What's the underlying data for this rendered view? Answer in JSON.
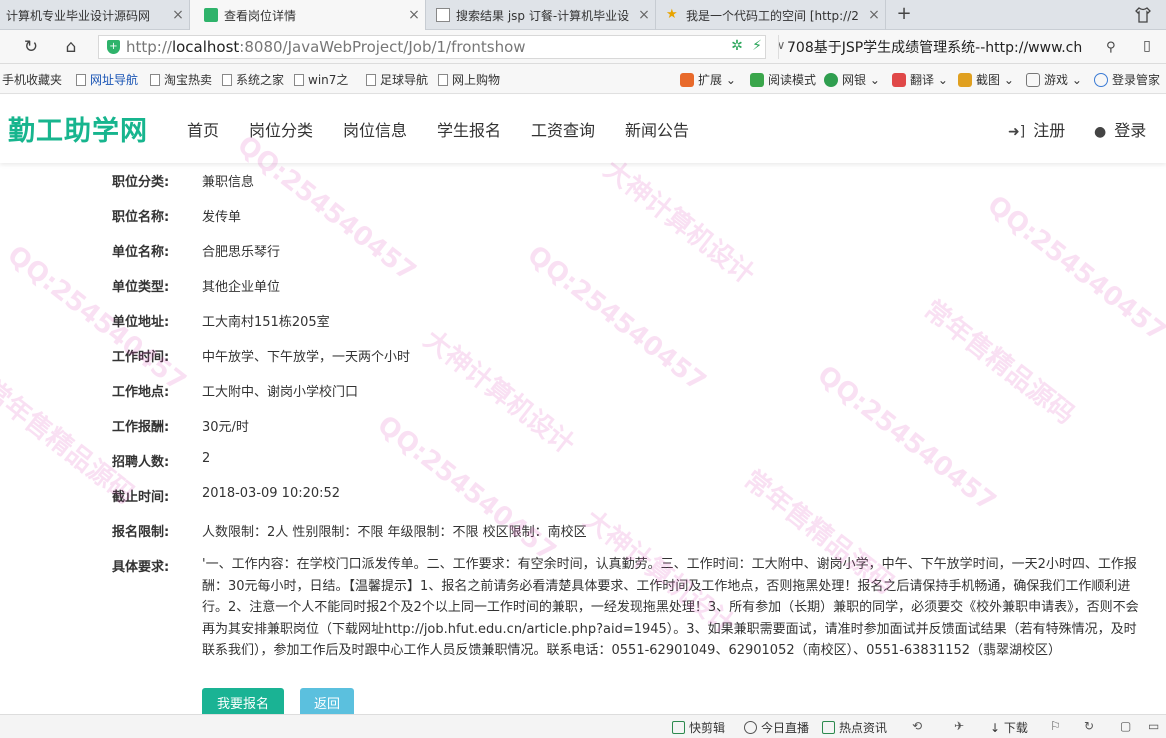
{
  "browser": {
    "tabs": [
      {
        "title": "计算机专业毕业设计源码网",
        "active": false
      },
      {
        "title": "查看岗位详情",
        "active": true
      },
      {
        "title": "搜索结果 jsp 订餐-计算机毕业设",
        "active": false
      },
      {
        "title": "我是一个代码工的空间 [http://2",
        "active": false
      }
    ],
    "new_tab_label": "+",
    "url_prefix": "http://",
    "url_host": "localhost",
    "url_rest": ":8080/JavaWebProject/Job/1/frontshow",
    "search_text": "708基于JSP学生成绩管理系统--http://www.ch",
    "bookmarks": [
      "手机收藏夹",
      "网址导航",
      "淘宝热卖",
      "系统之家",
      "win7之",
      "足球导航",
      "网上购物"
    ],
    "tools": [
      "扩展",
      "阅读模式",
      "网银",
      "翻译",
      "截图",
      "游戏",
      "登录管家"
    ]
  },
  "site": {
    "logo": "勤工助学网",
    "menu": [
      "首页",
      "岗位分类",
      "岗位信息",
      "学生报名",
      "工资查询",
      "新闻公告"
    ],
    "register": "注册",
    "login": "登录"
  },
  "job": {
    "fields": [
      {
        "label": "职位分类:",
        "value": "兼职信息"
      },
      {
        "label": "职位名称:",
        "value": "发传单"
      },
      {
        "label": "单位名称:",
        "value": "合肥思乐琴行"
      },
      {
        "label": "单位类型:",
        "value": "其他企业单位"
      },
      {
        "label": "单位地址:",
        "value": "工大南村151栋205室"
      },
      {
        "label": "工作时间:",
        "value": "中午放学、下午放学，一天两个小时"
      },
      {
        "label": "工作地点:",
        "value": "工大附中、谢岗小学校门口"
      },
      {
        "label": "工作报酬:",
        "value": "30元/时"
      },
      {
        "label": "招聘人数:",
        "value": "2"
      },
      {
        "label": "截止时间:",
        "value": "2018-03-09 10:20:52"
      },
      {
        "label": "报名限制:",
        "value": "人数限制：2人 性别限制：不限 年级限制：不限 校区限制：南校区"
      }
    ],
    "requirement_label": "具体要求:",
    "requirement": "'一、工作内容：在学校门口派发传单。二、工作要求：有空余时间，认真勤劳。三、工作时间：工大附中、谢岗小学，中午、下午放学时间，一天2小时四、工作报酬：30元每小时，日结。【温馨提示】1、报名之前请务必看清楚具体要求、工作时间及工作地点，否则拖黑处理！报名之后请保持手机畅通，确保我们工作顺利进行。2、注意一个人不能同时报2个及2个以上同一工作时间的兼职，一经发现拖黑处理！3、所有参加（长期）兼职的同学，必须要交《校外兼职申请表》，否则不会再为其安排兼职岗位（下载网址http://job.hfut.edu.cn/article.php?aid=1945）。3、如果兼职需要面试，请准时参加面试并反馈面试结果（若有特殊情况，及时联系我们），参加工作后及时跟中心工作人员反馈兼职情况。联系电话：0551-62901049、62901052（南校区）、0551-63831152（翡翠湖校区）",
    "apply_button": "我要报名",
    "back_button": "返回"
  },
  "statusbar": [
    "快剪辑",
    "今日直播",
    "热点资讯",
    "下载"
  ],
  "watermarks": [
    "QQ:254540457",
    "大神计算机设计",
    "常年售精品源码"
  ],
  "colors": {
    "brand": "#17b58e",
    "primary_button": "#1ab394",
    "info_button": "#5bc0de",
    "watermark": "#dc3cb4"
  }
}
